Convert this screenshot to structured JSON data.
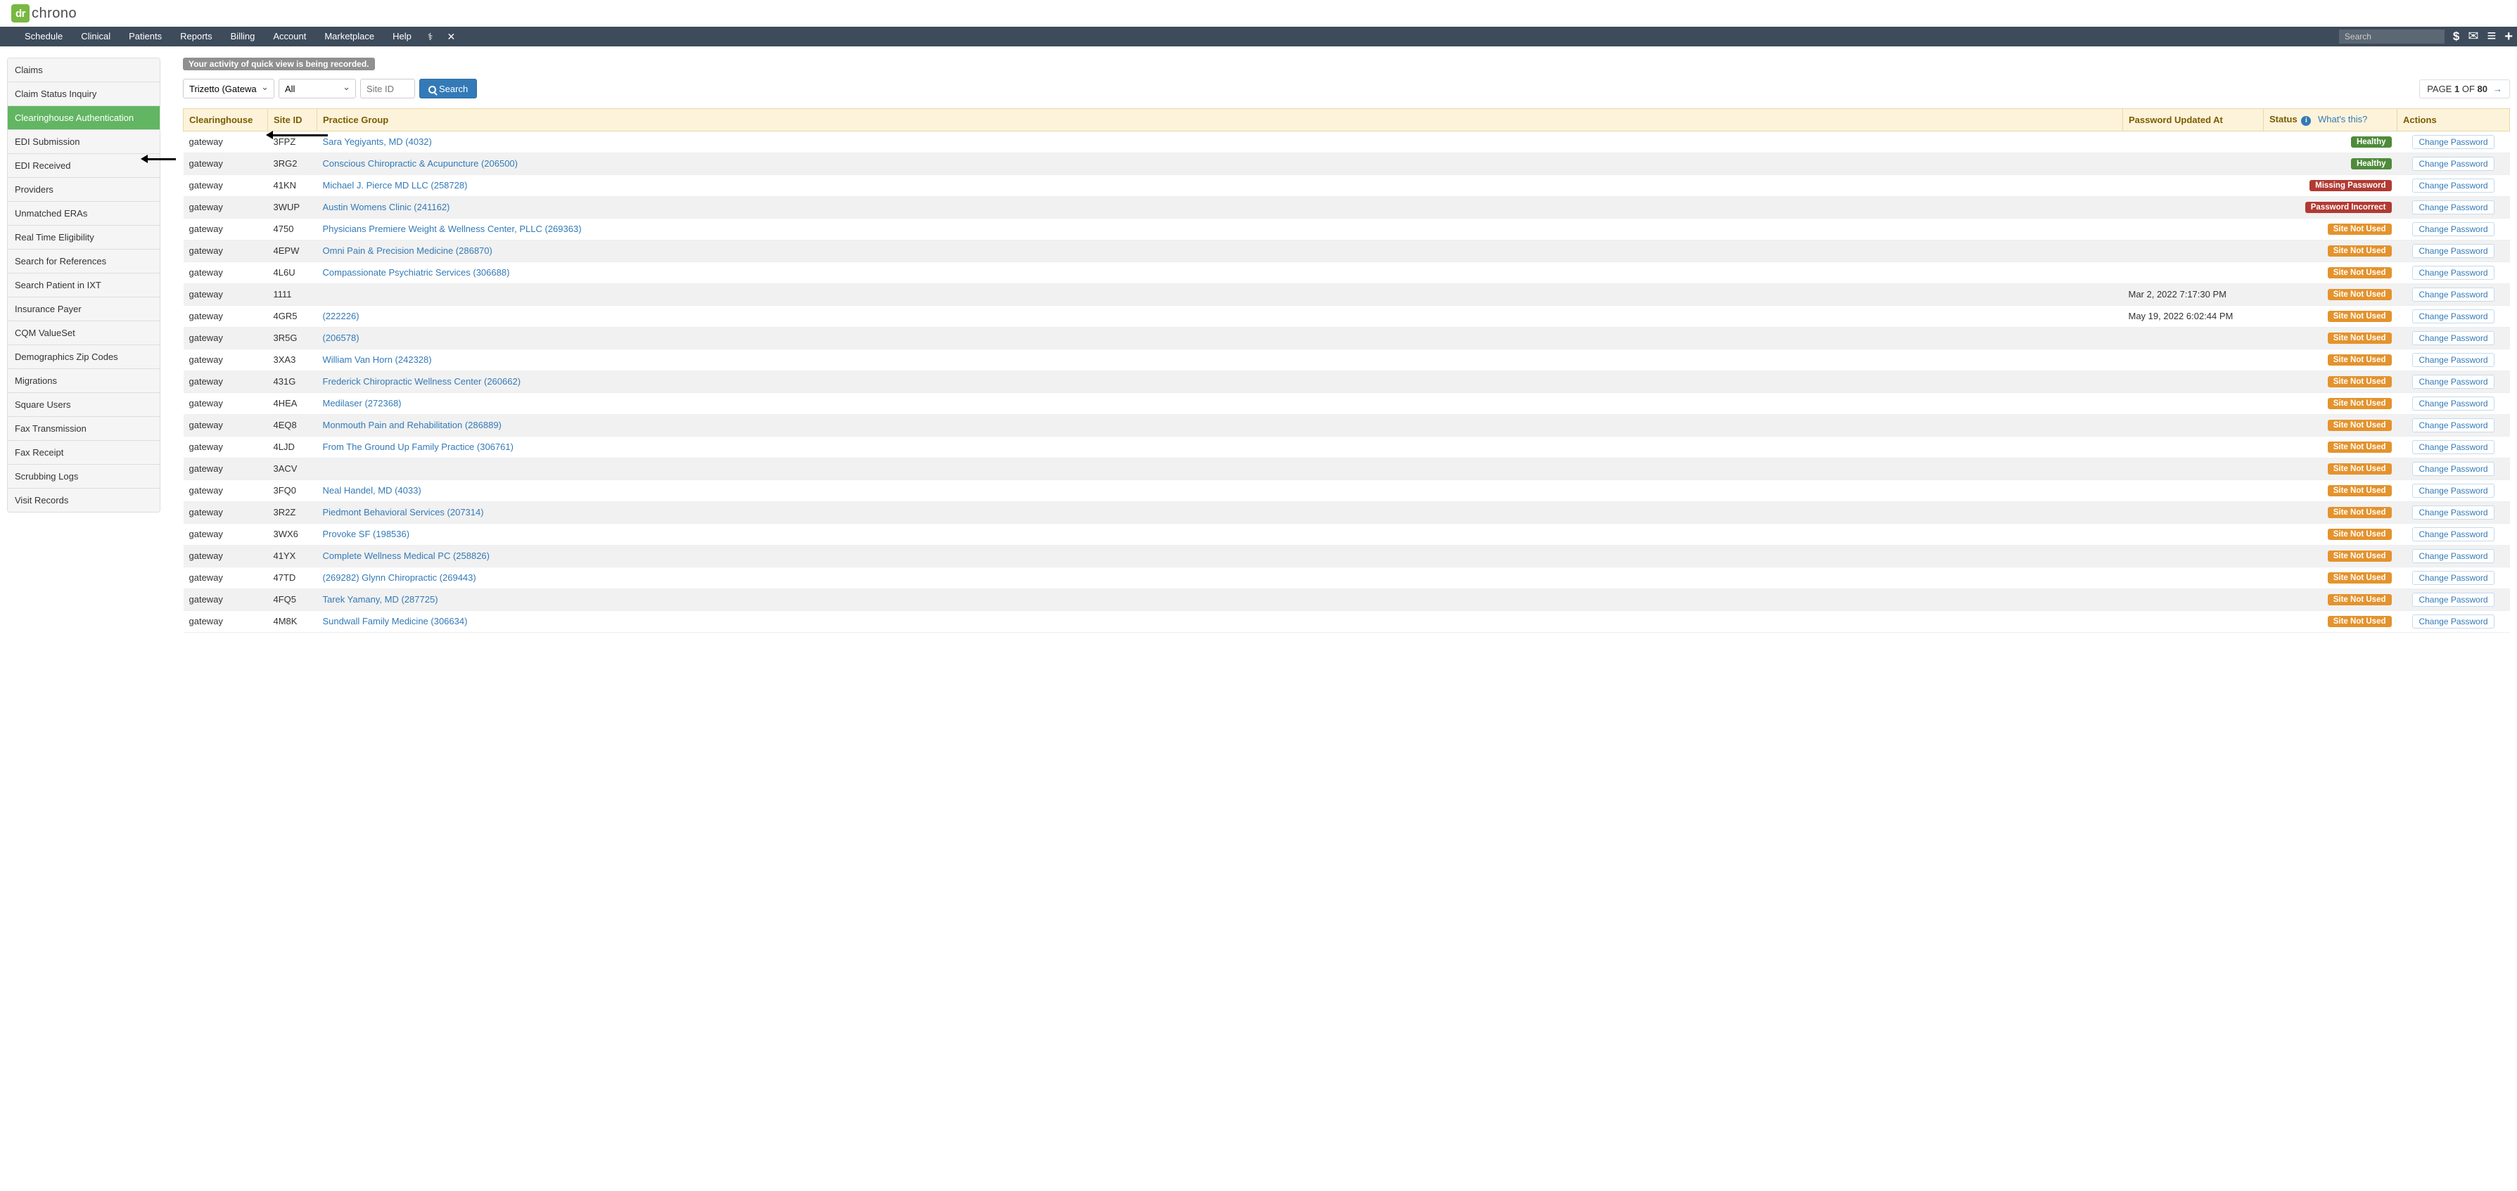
{
  "brand": {
    "logo": "dr",
    "name": "chrono"
  },
  "nav": {
    "items": [
      "Schedule",
      "Clinical",
      "Patients",
      "Reports",
      "Billing",
      "Account",
      "Marketplace",
      "Help"
    ],
    "search_placeholder": "Search"
  },
  "sidebar": {
    "items": [
      "Claims",
      "Claim Status Inquiry",
      "Clearinghouse Authentication",
      "EDI Submission",
      "EDI Received",
      "Providers",
      "Unmatched ERAs",
      "Real Time Eligibility",
      "Search for References",
      "Search Patient in IXT",
      "Insurance Payer",
      "CQM ValueSet",
      "Demographics Zip Codes",
      "Migrations",
      "Square Users",
      "Fax Transmission",
      "Fax Receipt",
      "Scrubbing Logs",
      "Visit Records"
    ],
    "active_index": 2
  },
  "banner": "Your activity of quick view is being recorded.",
  "filters": {
    "clearinghouse_options": [
      "Trizetto (Gateway)"
    ],
    "clearinghouse_selected": "Trizetto (Gateway)",
    "extra_options": [
      "All"
    ],
    "extra_selected": "All",
    "site_id_placeholder": "Site ID",
    "search_label": "Search"
  },
  "pagination": {
    "prefix": "PAGE",
    "current": "1",
    "of": "OF",
    "total": "80"
  },
  "table": {
    "headers": {
      "clearinghouse": "Clearinghouse",
      "site_id": "Site ID",
      "practice_group": "Practice Group",
      "password_updated": "Password Updated At",
      "status": "Status",
      "whats_this": "What's this?",
      "actions": "Actions"
    },
    "action_label": "Change Password",
    "status_labels": {
      "healthy": "Healthy",
      "missing": "Missing Password",
      "incorrect": "Password Incorrect",
      "notused": "Site Not Used"
    },
    "rows": [
      {
        "ch": "gateway",
        "site": "3FPZ",
        "pg": "Sara Yegiyants, MD (4032)",
        "upd": "",
        "status": "healthy"
      },
      {
        "ch": "gateway",
        "site": "3RG2",
        "pg": "Conscious Chiropractic & Acupuncture (206500)",
        "upd": "",
        "status": "healthy"
      },
      {
        "ch": "gateway",
        "site": "41KN",
        "pg": "Michael J. Pierce MD LLC (258728)",
        "upd": "",
        "status": "missing"
      },
      {
        "ch": "gateway",
        "site": "3WUP",
        "pg": "Austin Womens Clinic (241162)",
        "upd": "",
        "status": "incorrect"
      },
      {
        "ch": "gateway",
        "site": "4750",
        "pg": "Physicians Premiere Weight & Wellness Center, PLLC (269363)",
        "upd": "",
        "status": "notused"
      },
      {
        "ch": "gateway",
        "site": "4EPW",
        "pg": "Omni Pain & Precision Medicine (286870)",
        "upd": "",
        "status": "notused"
      },
      {
        "ch": "gateway",
        "site": "4L6U",
        "pg": "Compassionate Psychiatric Services (306688)",
        "upd": "",
        "status": "notused"
      },
      {
        "ch": "gateway",
        "site": "1111",
        "pg": "",
        "upd": "Mar 2, 2022 7:17:30 PM",
        "status": "notused"
      },
      {
        "ch": "gateway",
        "site": "4GR5",
        "pg": "(222226)",
        "upd": "May 19, 2022 6:02:44 PM",
        "status": "notused"
      },
      {
        "ch": "gateway",
        "site": "3R5G",
        "pg": "(206578)",
        "upd": "",
        "status": "notused"
      },
      {
        "ch": "gateway",
        "site": "3XA3",
        "pg": "William Van Horn (242328)",
        "upd": "",
        "status": "notused"
      },
      {
        "ch": "gateway",
        "site": "431G",
        "pg": "Frederick Chiropractic Wellness Center (260662)",
        "upd": "",
        "status": "notused"
      },
      {
        "ch": "gateway",
        "site": "4HEA",
        "pg": "Medilaser (272368)",
        "upd": "",
        "status": "notused"
      },
      {
        "ch": "gateway",
        "site": "4EQ8",
        "pg": "Monmouth Pain and Rehabilitation (286889)",
        "upd": "",
        "status": "notused"
      },
      {
        "ch": "gateway",
        "site": "4LJD",
        "pg": "From The Ground Up Family Practice (306761)",
        "upd": "",
        "status": "notused"
      },
      {
        "ch": "gateway",
        "site": "3ACV",
        "pg": "",
        "upd": "",
        "status": "notused"
      },
      {
        "ch": "gateway",
        "site": "3FQ0",
        "pg": "Neal Handel, MD (4033)",
        "upd": "",
        "status": "notused"
      },
      {
        "ch": "gateway",
        "site": "3R2Z",
        "pg": "Piedmont Behavioral Services (207314)",
        "upd": "",
        "status": "notused"
      },
      {
        "ch": "gateway",
        "site": "3WX6",
        "pg": "Provoke SF (198536)",
        "upd": "",
        "status": "notused"
      },
      {
        "ch": "gateway",
        "site": "41YX",
        "pg": "Complete Wellness Medical PC (258826)",
        "upd": "",
        "status": "notused"
      },
      {
        "ch": "gateway",
        "site": "47TD",
        "pg": "(269282) Glynn Chiropractic (269443)",
        "upd": "",
        "status": "notused"
      },
      {
        "ch": "gateway",
        "site": "4FQ5",
        "pg": "Tarek Yamany, MD (287725)",
        "upd": "",
        "status": "notused"
      },
      {
        "ch": "gateway",
        "site": "4M8K",
        "pg": "Sundwall Family Medicine (306634)",
        "upd": "",
        "status": "notused"
      }
    ]
  }
}
